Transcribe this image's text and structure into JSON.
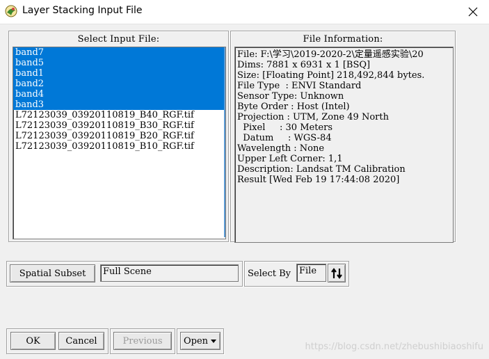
{
  "window": {
    "title": "Layer Stacking Input File"
  },
  "select_input": {
    "label": "Select Input File:",
    "items": [
      {
        "text": "band7",
        "selected": true
      },
      {
        "text": "band5",
        "selected": true
      },
      {
        "text": "band1",
        "selected": true
      },
      {
        "text": "band2",
        "selected": true
      },
      {
        "text": "band4",
        "selected": true
      },
      {
        "text": "band3",
        "selected": true
      },
      {
        "text": "L72123039_03920110819_B40_RGF.tif",
        "selected": false
      },
      {
        "text": "L72123039_03920110819_B30_RGF.tif",
        "selected": false
      },
      {
        "text": "L72123039_03920110819_B20_RGF.tif",
        "selected": false
      },
      {
        "text": "L72123039_03920110819_B10_RGF.tif",
        "selected": false
      }
    ]
  },
  "file_info": {
    "label": "File Information:",
    "lines": [
      "File: F:\\学习\\2019-2020-2\\定量遥感实验\\20",
      "Dims: 7881 x 6931 x 1 [BSQ]",
      "Size: [Floating Point] 218,492,844 bytes.",
      "File Type  : ENVI Standard",
      "Sensor Type: Unknown",
      "Byte Order : Host (Intel)",
      "Projection : UTM, Zone 49 North",
      "  Pixel     : 30 Meters",
      "  Datum     : WGS-84",
      "Wavelength : None",
      "Upper Left Corner: 1,1",
      "Description: Landsat TM Calibration",
      "Result [Wed Feb 19 17:44:08 2020]"
    ]
  },
  "subset": {
    "button_label": "Spatial Subset",
    "value": "Full Scene"
  },
  "select_by": {
    "label": "Select By",
    "value": "File"
  },
  "buttons": {
    "ok": "OK",
    "cancel": "Cancel",
    "previous": "Previous",
    "open": "Open"
  },
  "watermark": "https://blog.csdn.net/zhebushibiaoshifu",
  "colors": {
    "selection": "#0078d7",
    "background": "#f0f0f0"
  }
}
